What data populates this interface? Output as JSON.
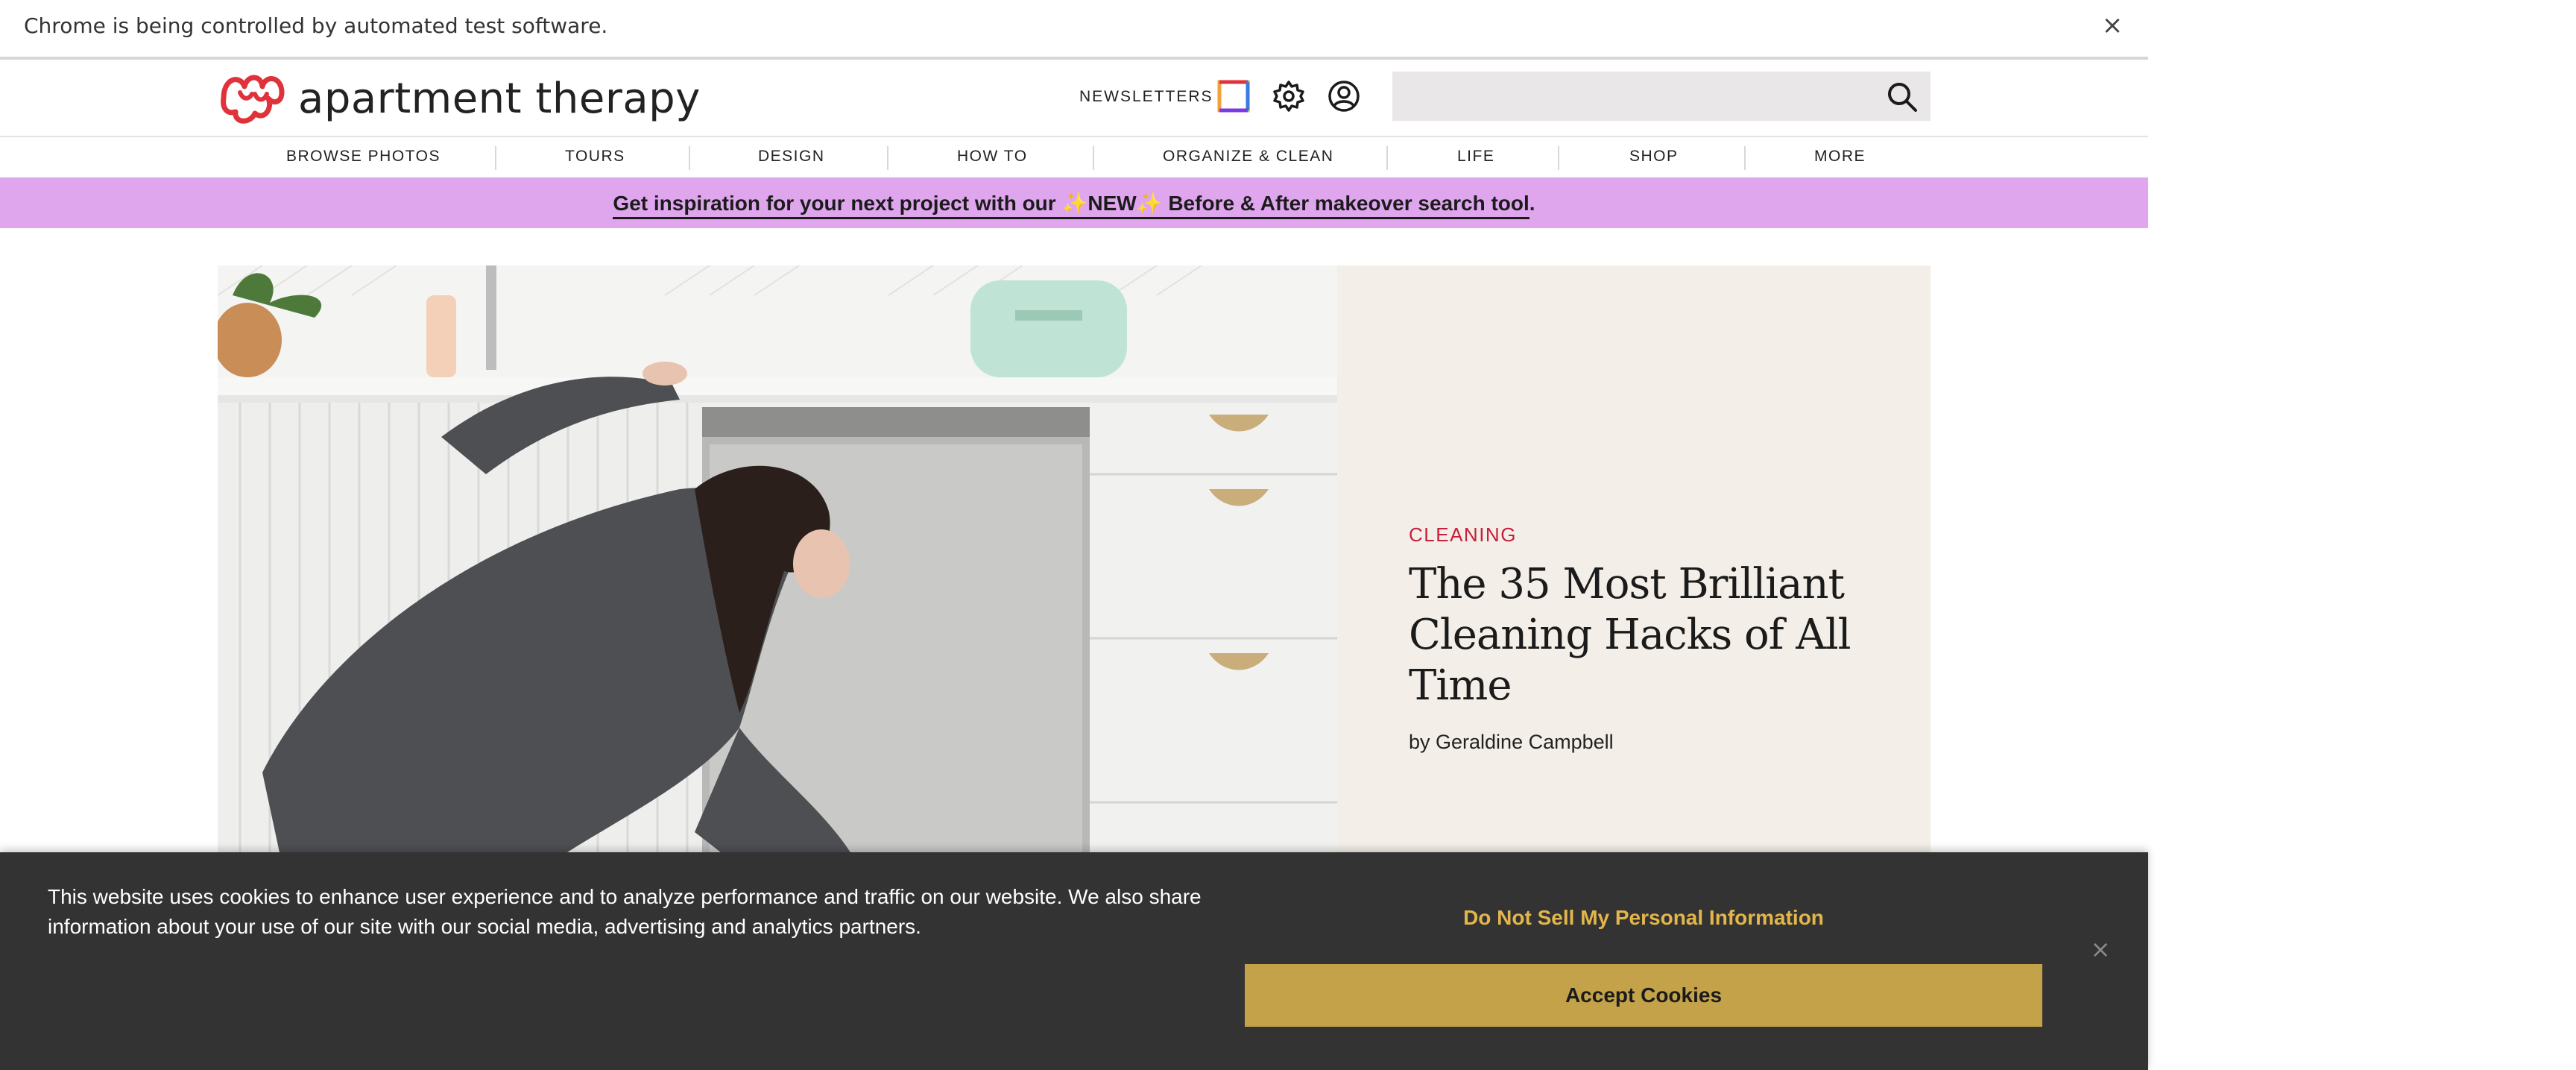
{
  "browser": {
    "automation_message": "Chrome is being controlled by automated test software.",
    "close_symbol": "×"
  },
  "header": {
    "logo_text": "apartment therapy",
    "newsletters_label": "NEWSLETTERS",
    "icons": [
      "color-square-icon",
      "gear-icon",
      "user-icon",
      "search-icon"
    ],
    "search": {
      "value": "",
      "placeholder": ""
    }
  },
  "nav": {
    "items": [
      {
        "label": "BROWSE PHOTOS"
      },
      {
        "label": "TOURS"
      },
      {
        "label": "DESIGN"
      },
      {
        "label": "HOW TO"
      },
      {
        "label": "ORGANIZE & CLEAN"
      },
      {
        "label": "LIFE"
      },
      {
        "label": "SHOP"
      },
      {
        "label": "MORE"
      }
    ]
  },
  "promo": {
    "text_before": "Get inspiration for your next project with our ",
    "spark": "✨",
    "new_label": "NEW",
    "text_after": " Before & After makeover search tool",
    "trailing": "."
  },
  "hero": {
    "category": "CLEANING",
    "headline": "The 35 Most Brilliant Cleaning Hacks of All Time",
    "byline": "by Geraldine Campbell"
  },
  "cookie_banner": {
    "message": "This website uses cookies to enhance user experience and to analyze performance and traffic on our website. We also share information about your use of our site with our social media, advertising and analytics partners.",
    "do_not_sell_label": "Do Not Sell My Personal Information",
    "accept_label": "Accept Cookies",
    "close_symbol": "×"
  },
  "colors": {
    "promo_bg": "#dfa6ee",
    "category_red": "#c8203a",
    "logo_red": "#e0323b",
    "cookie_bg": "#333333",
    "cookie_gold": "#c4a249",
    "dns_gold": "#e3b64b",
    "panel_bg": "#f3efe8"
  }
}
